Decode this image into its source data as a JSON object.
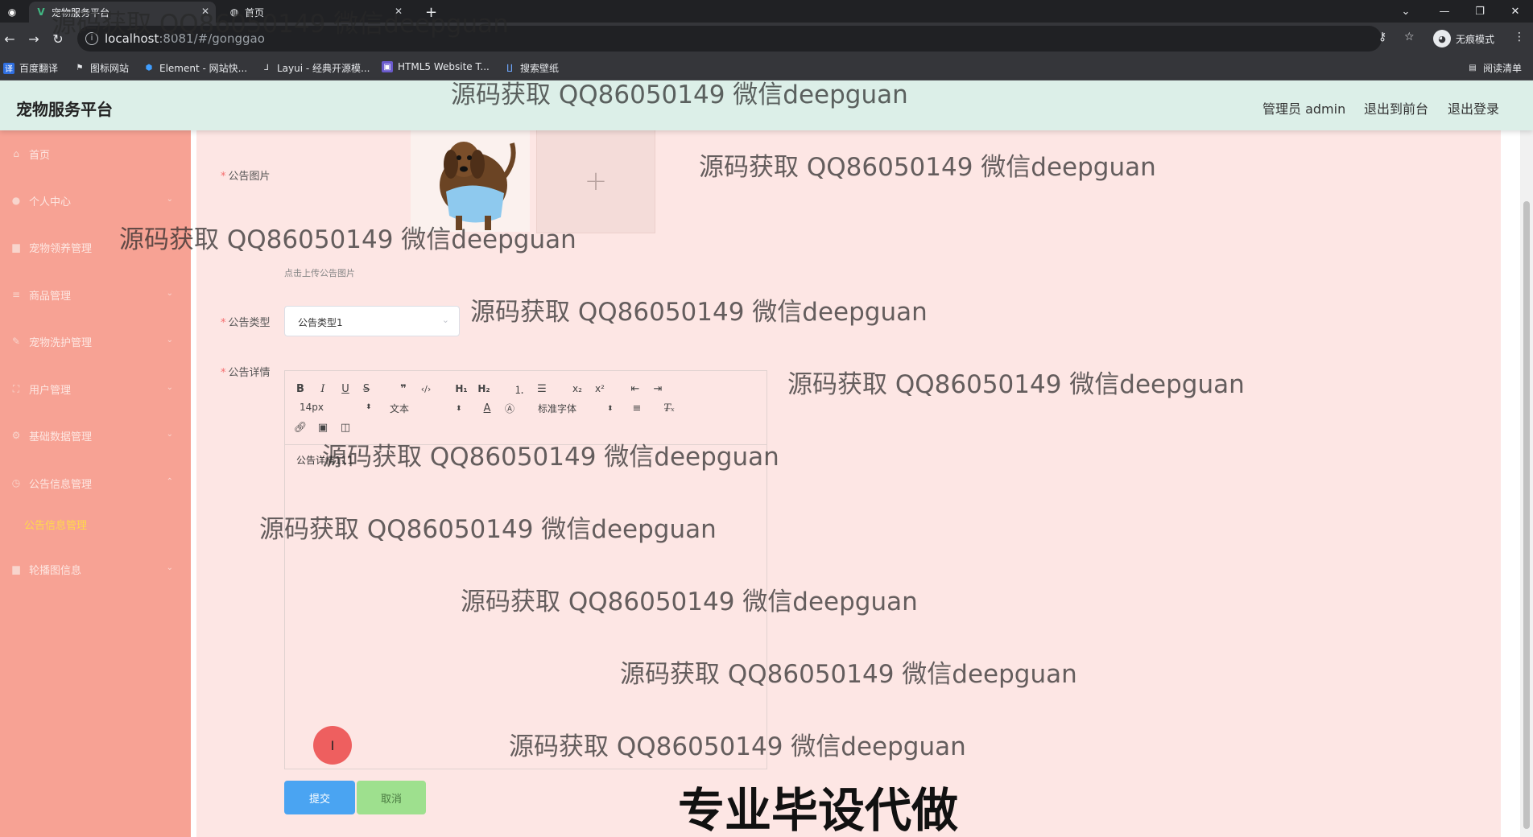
{
  "browser": {
    "tabs": [
      {
        "title": "宠物服务平台",
        "icon": "vue-logo-icon"
      },
      {
        "title": "首页",
        "icon": "globe-icon"
      }
    ],
    "url_host": "localhost",
    "url_path": ":8081/#/gonggao",
    "incognito_label": "无痕模式",
    "reading_list_label": "阅读清单",
    "bookmarks": [
      "百度翻译",
      "图标网站",
      "Element - 网站快...",
      "Layui - 经典开源模...",
      "HTML5 Website T...",
      "搜索壁纸"
    ]
  },
  "header": {
    "title": "宠物服务平台",
    "admin_label": "管理员 admin",
    "to_front_label": "退出到前台",
    "logout_label": "退出登录"
  },
  "sidebar": {
    "items": [
      {
        "label": "首页",
        "icon": "home-icon"
      },
      {
        "label": "个人中心",
        "icon": "user-icon"
      },
      {
        "label": "宠物领养管理",
        "icon": "clipboard-icon"
      },
      {
        "label": "商品管理",
        "icon": "list-icon"
      },
      {
        "label": "宠物洗护管理",
        "icon": "edit-icon"
      },
      {
        "label": "用户管理",
        "icon": "users-icon"
      },
      {
        "label": "基础数据管理",
        "icon": "settings-icon"
      },
      {
        "label": "公告信息管理",
        "icon": "clock-icon"
      },
      {
        "label": "轮播图信息",
        "icon": "image-icon"
      }
    ],
    "sub_item": "公告信息管理"
  },
  "form": {
    "image_label": "公告图片",
    "upload_hint": "点击上传公告图片",
    "type_label": "公告类型",
    "type_value": "公告类型1",
    "detail_label": "公告详情",
    "font_size": "14px",
    "text_format": "文本",
    "font_family": "标准字体",
    "detail_content": "公告详情111",
    "submit_label": "提交",
    "cancel_label": "取消"
  },
  "overlay": {
    "watermark": "源码获取 QQ86050149 微信deepguan",
    "promo": "专业毕设代做"
  }
}
